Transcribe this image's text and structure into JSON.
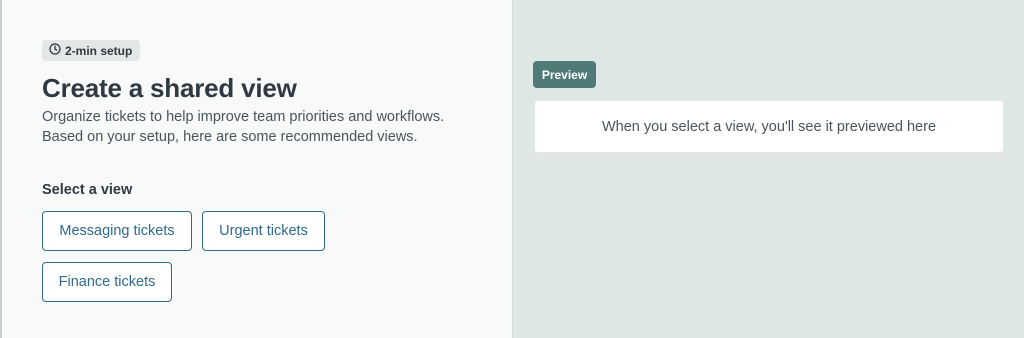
{
  "setup": {
    "badge_label": "2-min setup",
    "badge_icon": "clock-icon",
    "title": "Create a shared view",
    "description_line1": "Organize tickets to help improve team priorities and workflows.",
    "description_line2": "Based on your setup, here are some recommended views."
  },
  "views": {
    "section_label": "Select a view",
    "options": [
      {
        "label": "Messaging tickets"
      },
      {
        "label": "Urgent tickets"
      },
      {
        "label": "Finance tickets"
      }
    ]
  },
  "preview": {
    "tag_label": "Preview",
    "placeholder": "When you select a view, you'll see it previewed here"
  },
  "colors": {
    "accent": "#2f6a8f",
    "preview_tag": "#4f7a78",
    "right_panel_bg": "#dfe6e6"
  }
}
